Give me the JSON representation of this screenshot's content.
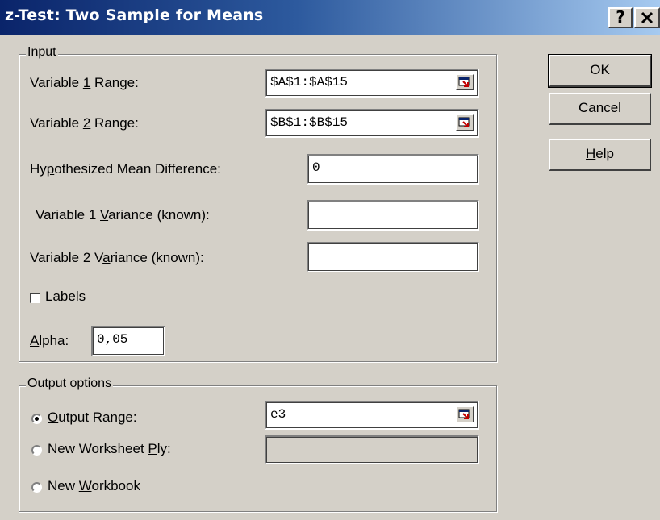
{
  "window": {
    "title": "z-Test: Two Sample for Means",
    "help_glyph": "?",
    "close_glyph": "✕"
  },
  "input_group": {
    "title": "Input",
    "var1_range": {
      "label_pre": "Variable ",
      "label_key": "1",
      "label_post": " Range:",
      "value": "$A$1:$A$15"
    },
    "var2_range": {
      "label_pre": "Variable ",
      "label_key": "2",
      "label_post": " Range:",
      "value": "$B$1:$B$15"
    },
    "hyp_mean_diff": {
      "label_pre": "Hy",
      "label_key": "p",
      "label_post": "othesized Mean Difference:",
      "value": "0"
    },
    "var1_variance": {
      "label_pre": "Variable 1 ",
      "label_key": "V",
      "label_post": "ariance (known):",
      "value": ""
    },
    "var2_variance": {
      "label_pre": "Variable 2 V",
      "label_key": "a",
      "label_post": "riance (known):",
      "value": ""
    },
    "labels": {
      "label_key": "L",
      "label_post": "abels",
      "checked": false
    },
    "alpha": {
      "label_key": "A",
      "label_post": "lpha:",
      "value": "0,05"
    }
  },
  "output_group": {
    "title": "Output options",
    "output_range": {
      "label_key": "O",
      "label_post": "utput Range:",
      "value": "e3",
      "selected": true
    },
    "new_worksheet": {
      "label_pre": "New Worksheet ",
      "label_key": "P",
      "label_post": "ly:",
      "value": "",
      "selected": false
    },
    "new_workbook": {
      "label_pre": "New ",
      "label_key": "W",
      "label_post": "orkbook",
      "selected": false
    }
  },
  "buttons": {
    "ok": "OK",
    "cancel": "Cancel",
    "help_key": "H",
    "help_post": "elp"
  },
  "colors": {
    "face": "#d4d0c8",
    "title_start": "#0a246a",
    "title_end": "#a6caf0"
  }
}
